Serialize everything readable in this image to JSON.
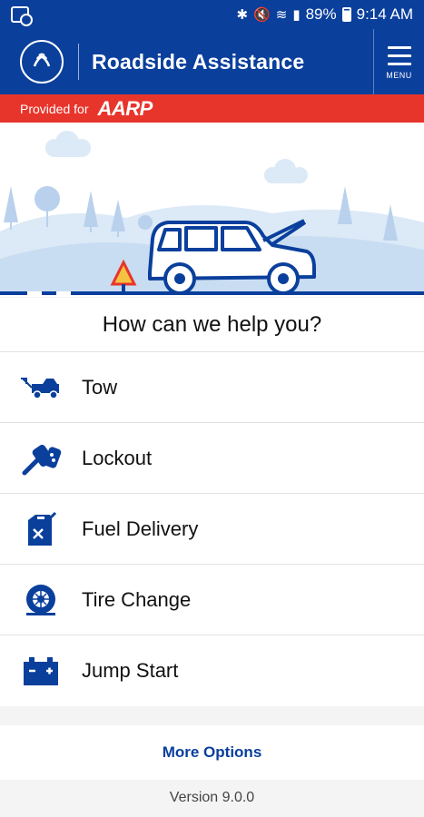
{
  "status_bar": {
    "battery": "89%",
    "time": "9:14 AM",
    "icons": [
      "bluetooth-icon",
      "mute-icon",
      "wifi-icon",
      "signal-icon",
      "battery-icon"
    ]
  },
  "header": {
    "title": "Roadside Assistance",
    "menu_label": "MENU"
  },
  "provided_bar": {
    "text": "Provided for",
    "brand": "AARP"
  },
  "main": {
    "prompt": "How can we help you?"
  },
  "services": [
    {
      "label": "Tow",
      "icon": "tow-truck-icon"
    },
    {
      "label": "Lockout",
      "icon": "car-key-icon"
    },
    {
      "label": "Fuel Delivery",
      "icon": "fuel-can-icon"
    },
    {
      "label": "Tire Change",
      "icon": "tire-icon"
    },
    {
      "label": "Jump Start",
      "icon": "battery-icon"
    }
  ],
  "footer": {
    "more_options": "More Options",
    "version": "Version 9.0.0"
  },
  "colors": {
    "primary": "#0a3f9c",
    "accent": "#e8352b",
    "hero_bg": "#dce9f7"
  }
}
